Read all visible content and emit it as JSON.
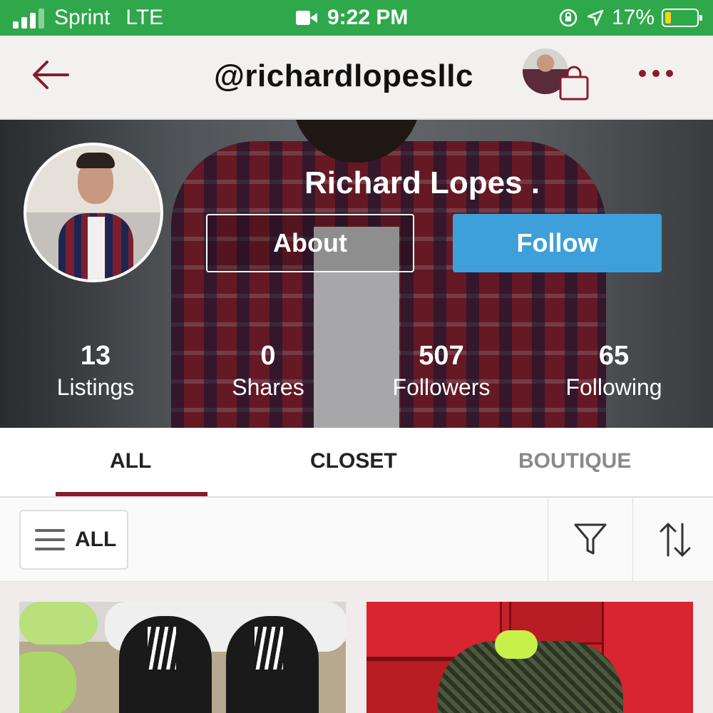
{
  "status_bar": {
    "carrier": "Sprint",
    "network": "LTE",
    "time": "9:22 PM",
    "battery": "17%",
    "colors": {
      "bar": "#2ea84a",
      "battery_level": "#ffd11a"
    }
  },
  "header": {
    "handle": "@richardlopesllc",
    "icons": [
      "back-arrow-icon",
      "avatar",
      "shopping-bag-icon",
      "more-icon"
    ],
    "accent": "#8a1b2b"
  },
  "profile": {
    "name": "Richard Lopes .",
    "about_label": "About",
    "follow_label": "Follow",
    "follow_color": "#3ea0da",
    "stats": [
      {
        "value": "13",
        "label": "Listings"
      },
      {
        "value": "0",
        "label": "Shares"
      },
      {
        "value": "507",
        "label": "Followers"
      },
      {
        "value": "65",
        "label": "Following"
      }
    ]
  },
  "tabs": [
    {
      "label": "ALL",
      "active": true
    },
    {
      "label": "CLOSET",
      "active": false
    },
    {
      "label": "BOUTIQUE",
      "active": false
    }
  ],
  "filters": {
    "category_label": "ALL",
    "icons": [
      "menu-icon",
      "filter-icon",
      "sort-icon"
    ]
  },
  "listings": [
    {
      "name": "listing-yeezy-sneakers"
    },
    {
      "name": "listing-nike-boxes-sneakers"
    }
  ]
}
